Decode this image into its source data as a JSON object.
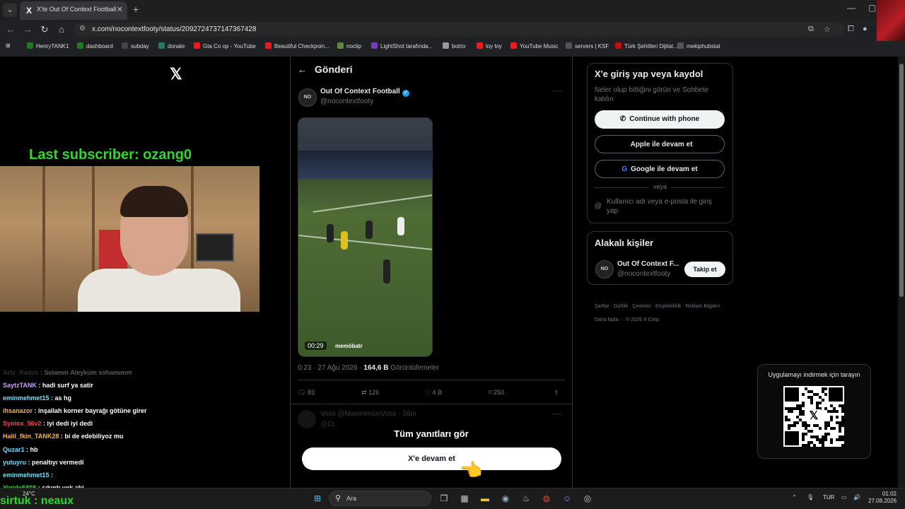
{
  "browser": {
    "tab_title": "X'te Out Of Context Football / X",
    "tab_favicon": "X",
    "url": "x.com/nocontextfooty/status/2092724737147367428",
    "bookmarks": [
      {
        "label": "HenryTANK1",
        "color": "#1f7a1f"
      },
      {
        "label": "dashboard",
        "color": "#1f7a1f"
      },
      {
        "label": "subday",
        "color": "#444444"
      },
      {
        "label": "donate",
        "color": "#2a7a5a"
      },
      {
        "label": "Gta Co op - YouTube",
        "color": "#e02020"
      },
      {
        "label": "Beautiful Checkpoin...",
        "color": "#e02020"
      },
      {
        "label": "noclip",
        "color": "#5a8a3a"
      },
      {
        "label": "LightShot tarafında...",
        "color": "#7a3ac0"
      },
      {
        "label": "botrix",
        "color": "#999999"
      },
      {
        "label": "loy loy",
        "color": "#e02020"
      },
      {
        "label": "YouTube Music",
        "color": "#e02020"
      },
      {
        "label": "servers | KSF",
        "color": "#555555"
      },
      {
        "label": "Türk Şehitleri Dijital...",
        "color": "#c01010"
      },
      {
        "label": "mekiphubstat",
        "color": "#555555"
      }
    ]
  },
  "stream": {
    "last_subscriber": "Last subscriber: ozang0",
    "bottom_label": "sirtuk : neaux",
    "chat": [
      {
        "user": "Arte_Rados",
        "msg": "Selamın Aleyküm sohamımm",
        "color": "#888888",
        "faded": true
      },
      {
        "user": "SaytzTANK",
        "msg": "hadi surf ya satir",
        "color": "#c8a0ff",
        "faded": false
      },
      {
        "user": "eminmehmet15",
        "msg": "as hg",
        "color": "#6fe0ff",
        "faded": false
      },
      {
        "user": "ihsanazor",
        "msg": "inşallah korner bayrağı götüne girer",
        "color": "#ffb347",
        "faded": false
      },
      {
        "user": "Syniox_56v2",
        "msg": "iyi dedi iyi dedi",
        "color": "#ff4444",
        "faded": false
      },
      {
        "user": "Halil_fkin_TANK28",
        "msg": "bi de edebiliyoz mu",
        "color": "#ffb347",
        "faded": false
      },
      {
        "user": "Quzar1",
        "msg": "hb",
        "color": "#6fe0ff",
        "faded": false
      },
      {
        "user": "yutuyru",
        "msg": "penaltıyı vermedi",
        "color": "#6fe0ff",
        "faded": false
      },
      {
        "user": "eminmehmet15",
        "msg": "",
        "color": "#6fe0ff",
        "faded": false
      },
      {
        "user": "Yigido5808",
        "msg": "sıkıntı yok abi",
        "color": "#2bd92b",
        "faded": false
      }
    ]
  },
  "post": {
    "header": "Gönderi",
    "author_name": "Out Of Context Football",
    "author_handle": "@nocontextfooty",
    "avatar_text": "NO",
    "video_time": "00:29",
    "video_watermark": "memöbatr",
    "meta_time": "0:23 · 27 Ağu 2026 · ",
    "meta_views_num": "164,6 B",
    "meta_views_label": " Görüntülemeler",
    "replies": "83",
    "reposts": "126",
    "likes": "4 B",
    "bookmarks": "250",
    "reply_preview_name": "Voss @MaximmionVoss · 36m",
    "reply_preview_sub": "@DL",
    "see_all": "Tüm yanıtları gör",
    "continue": "X'e devam et"
  },
  "signup": {
    "title": "X'e giriş yap veya kaydol",
    "subtitle": "Neler olup bittiğini görün ve Sohbete katılın",
    "phone": "Continue with phone",
    "apple": "Apple ile devam et",
    "google": "Google ile devam et",
    "or": "veya",
    "login": "Kullanıcı adı veya e-posta ile giriş yap"
  },
  "related": {
    "title": "Alakalı kişiler",
    "name": "Out Of Context F...",
    "handle": "@nocontextfooty",
    "follow": "Takip et"
  },
  "footer": {
    "links": "Şartlar · Gizlilik · Çerezler · Erişilebilirlik · Reklam Bilgileri · Daha fazla ··· © 2026 X Corp."
  },
  "qr": {
    "label": "Uygulamayı indirmek için tarayın"
  },
  "taskbar": {
    "search": "Ara",
    "weather": "24°C",
    "lang": "TUR",
    "time": "01:02",
    "date": "27.08.2026"
  }
}
